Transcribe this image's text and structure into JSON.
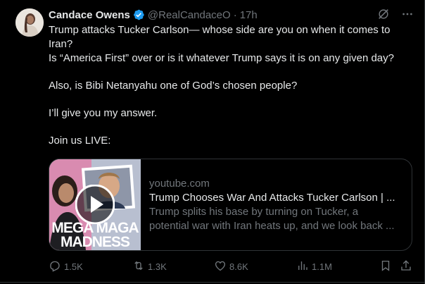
{
  "author": {
    "display_name": "Candace Owens",
    "handle": "@RealCandaceO",
    "separator": "·",
    "time": "17h",
    "verified_color": "#1d9bf0"
  },
  "icons": {
    "grok": "grok-icon",
    "more": "more-icon",
    "verified": "verified-badge-icon",
    "play": "play-icon",
    "reply": "reply-icon",
    "repost": "repost-icon",
    "like": "like-icon",
    "views": "views-icon",
    "bookmark": "bookmark-icon",
    "share": "share-icon"
  },
  "tweet": {
    "line1": "Trump attacks Tucker Carlson— whose side are you on when it comes to Iran?",
    "line2": "Is “America First” over or is it whatever Trump says it is on any given day?",
    "line3": "Also, is Bibi Netanyahu one of God’s chosen people?",
    "line4": "I’ll give you my answer.",
    "line5": "Join us LIVE:"
  },
  "card": {
    "domain": "youtube.com",
    "title": "Trump Chooses War And Attacks Tucker Carlson | ...",
    "desc_line1": "Trump splits his base by turning on Tucker, a",
    "desc_line2": "potential war with Iran heats up, and we look back ...",
    "thumb_text_line1": "MEGA MAGA",
    "thumb_text_line2": "MADNESS"
  },
  "actions": {
    "replies": "1.5K",
    "reposts": "1.3K",
    "likes": "8.6K",
    "views": "1.1M"
  },
  "colors": {
    "background": "#000000",
    "text": "#e7e9ea",
    "muted": "#71767b",
    "border": "#2f3336",
    "accent": "#1d9bf0"
  }
}
